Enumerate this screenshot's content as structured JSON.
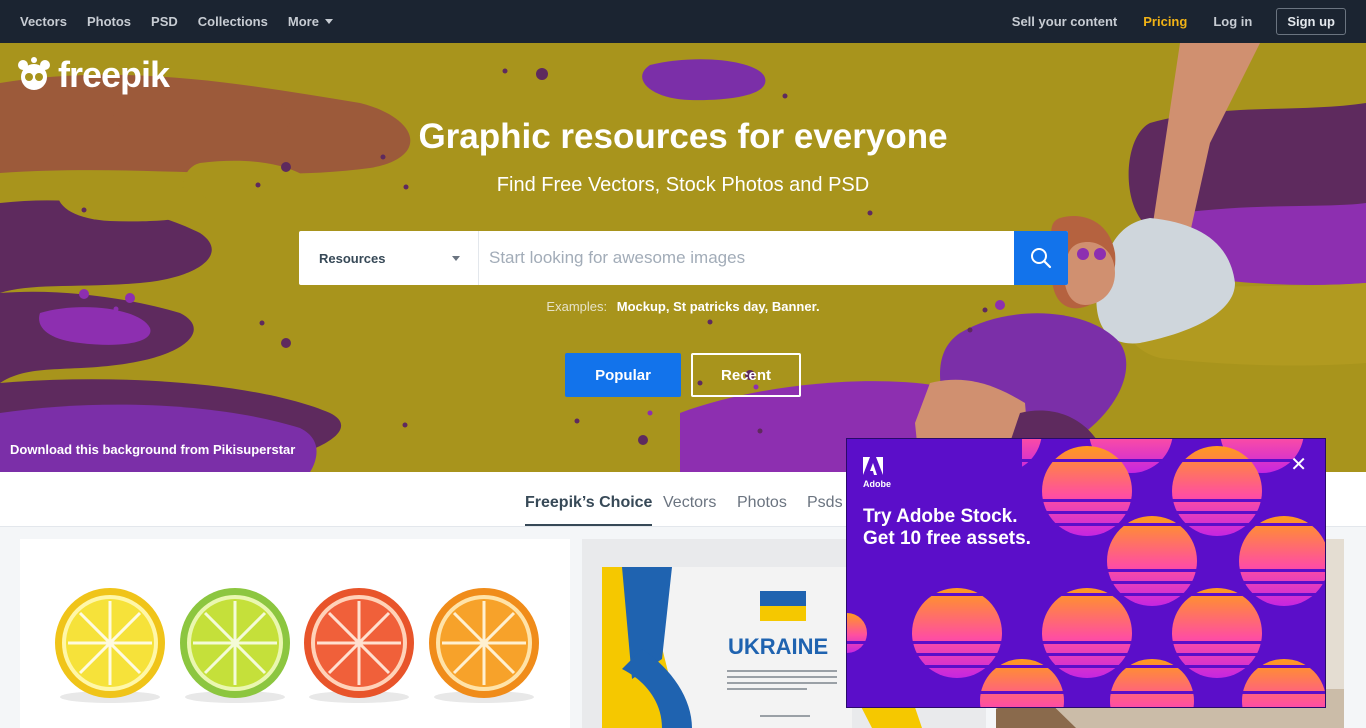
{
  "nav": {
    "left": [
      "Vectors",
      "Photos",
      "PSD",
      "Collections",
      "More"
    ],
    "right": {
      "sell": "Sell your content",
      "pricing": "Pricing",
      "login": "Log in",
      "signup": "Sign up"
    }
  },
  "hero": {
    "logo": "freepik",
    "title": "Graphic resources for everyone",
    "subtitle": "Find Free Vectors, Stock Photos and PSD",
    "search": {
      "category": "Resources",
      "placeholder": "Start looking for awesome images"
    },
    "examples_label": "Examples:",
    "examples": [
      "Mockup",
      "St patricks day",
      "Banner"
    ],
    "popular": "Popular",
    "recent": "Recent",
    "credit": "Download this background from Pikisuperstar"
  },
  "tabs": [
    "Freepik’s Choice",
    "Vectors",
    "Photos",
    "Psds"
  ],
  "cards": {
    "ukraine_title": "UKRAINE"
  },
  "ad": {
    "brand": "Adobe",
    "line1": "Try Adobe Stock.",
    "line2": "Get 10 free assets."
  },
  "colors": {
    "accent": "#1273eb",
    "pricing": "#f2b316",
    "nav_bg": "#1b2431",
    "ad_bg": "#5b0ec9"
  }
}
